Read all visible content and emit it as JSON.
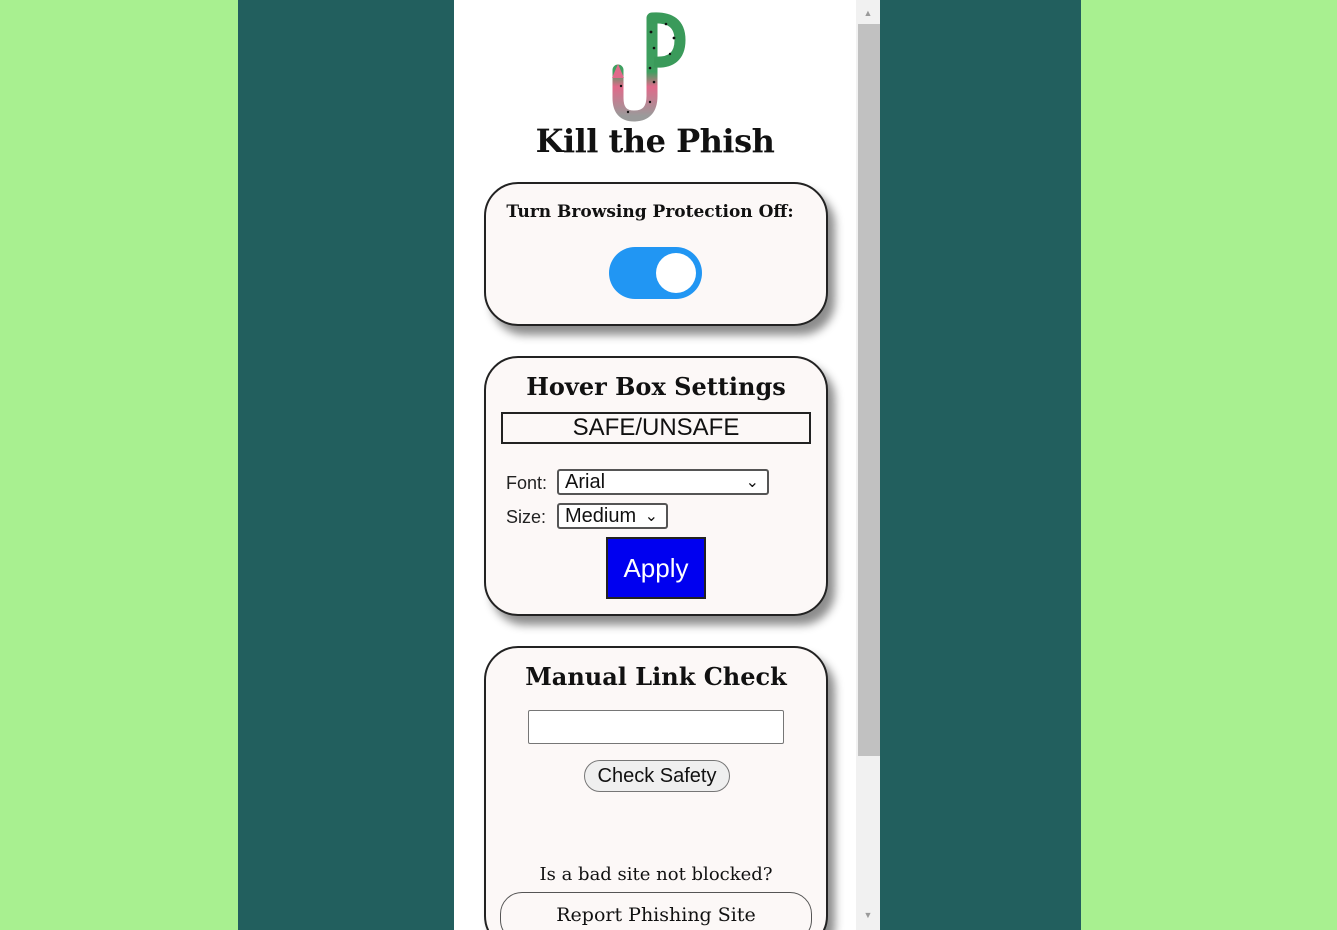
{
  "app": {
    "title": "Kill the Phish",
    "logo": "fishing-hook-letter-p-logo"
  },
  "protection": {
    "label": "Turn Browsing Protection Off:",
    "toggle_on": true
  },
  "hover_box": {
    "heading": "Hover Box Settings",
    "preview_text": "SAFE/UNSAFE",
    "font_label": "Font:",
    "font_value": "Arial",
    "size_label": "Size:",
    "size_value": "Medium",
    "apply_label": "Apply"
  },
  "manual_check": {
    "heading": "Manual Link Check",
    "input_value": "",
    "check_label": "Check Safety",
    "bad_site_prompt": "Is a bad site not blocked?",
    "report_label": "Report Phishing Site"
  },
  "colors": {
    "outer_bg": "#a8f090",
    "backdrop": "#225f5e",
    "card_bg": "#fcf8f7",
    "toggle_on": "#2196f3",
    "apply_bg": "#0000f0"
  }
}
